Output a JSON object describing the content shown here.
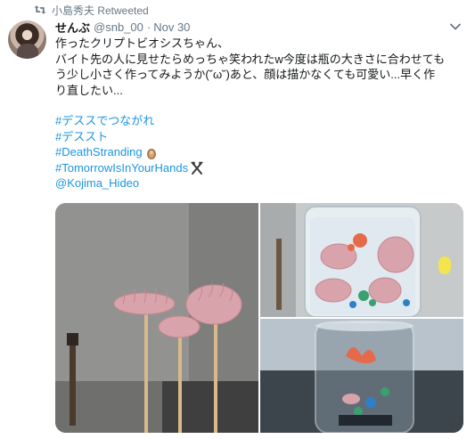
{
  "retweet": {
    "text": "小島秀夫 Retweeted"
  },
  "tweet": {
    "display_name": "せんぶ",
    "handle": "@snb_00",
    "separator": "·",
    "date": "Nov 30",
    "body_lines": [
      "作ったクリプトビオシスちゃん、",
      "バイト先の人に見せたらめっちゃ笑われたw今度は瓶の大きさに合わせても",
      "う少し小さく作ってみようか(˘ω˘)あと、顔は描かなくても可愛い...早く作",
      "り直したい..."
    ],
    "hashtags": [
      "#デススでつながれ",
      "#デススト",
      "#DeathStranding",
      "#TomorrowIsInYourHands"
    ],
    "mention": "@Kojima_Hideo"
  },
  "icons": {
    "retweet": "retweet-icon",
    "caret": "chevron-down-icon",
    "bb_emoji": "bridge-baby-emoji",
    "tools_emoji": "crossed-tools-emoji"
  },
  "colors": {
    "link": "#1b95e0",
    "muted": "#657786",
    "text": "#14171a",
    "worm": "#d9a3ab"
  }
}
